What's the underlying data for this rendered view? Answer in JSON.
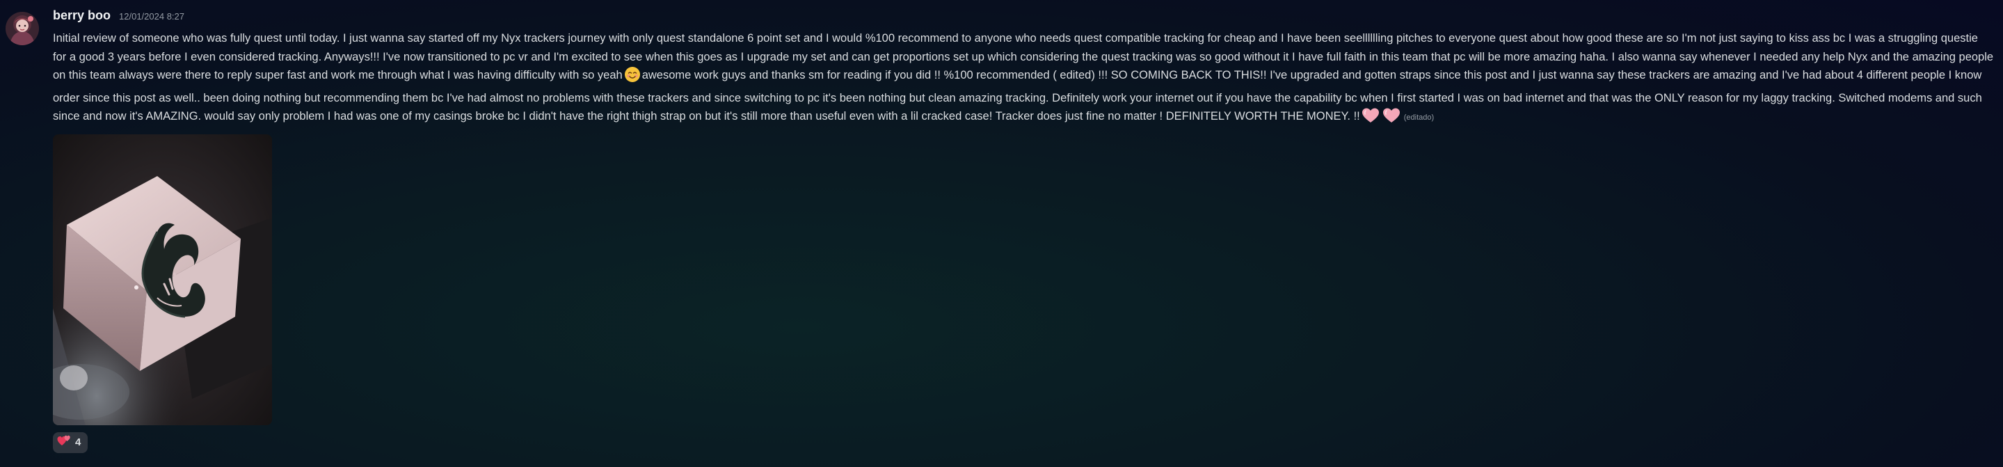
{
  "message": {
    "author": "berry boo",
    "timestamp": "12/01/2024 8:27",
    "text_part1": "Initial review of someone who was fully quest until today. I just wanna say started off my Nyx trackers journey with only quest standalone 6 point set and I would %100 recommend to anyone who needs quest compatible tracking for cheap and I have been seelllllling pitches to everyone quest about how good these are so I'm not just saying to kiss ass bc I was a struggling questie for a good 3 years before I even considered tracking. Anyways!!! I've now transitioned to pc vr and I'm excited to see when this goes as I upgrade my set and can get proportions set up which considering the quest tracking was so good without it I have full faith in this team that pc will be more amazing haha. I also wanna say whenever I needed any help Nyx and the amazing people on this team always were there to reply super fast and work me through what I was having difficulty with so yeah",
    "text_part2": "awesome work guys and thanks sm for reading if you did !! %100 recommended ( edited) !!! SO COMING BACK TO THIS!! I've upgraded and gotten straps since this post and I just wanna say these trackers are amazing and I've had about 4 different people I know order since this post as well.. been doing nothing but recommending them bc I've had almost no problems with these trackers and since switching to pc it's been nothing but clean amazing tracking. Definitely work your internet out if you have the capability bc when I first started I was on bad internet and that was the ONLY reason for my laggy tracking. Switched modems and such since and now it's AMAZING. would say only problem I had was one of my casings broke bc I didn't have the right thigh strap on but it's still more than useful even with a lil cracked case! Tracker does just fine no matter ! DEFINITELY WORTH THE MONEY. !!",
    "edited_label": "(editado)",
    "inline_emojis": [
      "smiling-face-with-smiling-eyes-emoji",
      "pink-heart-emoji",
      "pink-heart-emoji"
    ],
    "attachment": {
      "kind": "image",
      "description_icon": "tracker-photo"
    },
    "reactions": [
      {
        "emoji": "two-hearts-emoji",
        "count": "4"
      }
    ]
  },
  "colors": {
    "username": "#f2f3f5",
    "timestamp": "#949ba4",
    "text": "#dbdee1",
    "reaction_bg": "#4e5058",
    "heart": "#f4a7b9"
  }
}
